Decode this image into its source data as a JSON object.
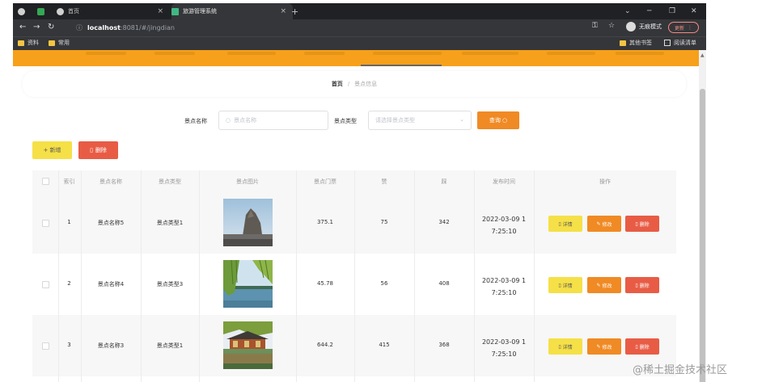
{
  "browser": {
    "tabs": [
      {
        "title": ""
      },
      {
        "title": ""
      },
      {
        "title": "首页"
      },
      {
        "title": "旅游管理系统"
      }
    ],
    "new_tab": "+",
    "url_host": "localhost",
    "url_path": ":8081/#/jingdian",
    "incognito_label": "无痕模式",
    "update_label": "更新",
    "bookmarks": [
      {
        "label": "资料"
      },
      {
        "label": "常用"
      }
    ],
    "bookmarks_right": [
      {
        "label": "其他书签"
      },
      {
        "label": "阅读清单"
      }
    ]
  },
  "breadcrumb": {
    "home": "首页",
    "separator": "/",
    "current": "景点信息"
  },
  "search": {
    "name_label": "景点名称",
    "name_placeholder": "景点名称",
    "type_label": "景点类型",
    "type_placeholder": "请选择景点类型",
    "query_label": "查询 ○"
  },
  "toolbar": {
    "add_label": "+ 新增",
    "delete_label": "删除"
  },
  "table": {
    "headers": [
      "索引",
      "景点名称",
      "景点类型",
      "景点图片",
      "景点门票",
      "赞",
      "踩",
      "发布时间",
      "操作"
    ],
    "rows": [
      {
        "index": "1",
        "name": "景点名称5",
        "type": "景点类型1",
        "price": "375.1",
        "likes": "75",
        "dislikes": "342",
        "time_line1": "2022-03-09 1",
        "time_line2": "7:25:10"
      },
      {
        "index": "2",
        "name": "景点名称4",
        "type": "景点类型3",
        "price": "45.78",
        "likes": "56",
        "dislikes": "408",
        "time_line1": "2022-03-09 1",
        "time_line2": "7:25:10"
      },
      {
        "index": "3",
        "name": "景点名称3",
        "type": "景点类型1",
        "price": "644.2",
        "likes": "415",
        "dislikes": "368",
        "time_line1": "2022-03-09 1",
        "time_line2": "7:25:10"
      }
    ],
    "actions": {
      "detail": "详情",
      "edit": "修改",
      "remove": "删除"
    }
  },
  "watermark": "@稀土掘金技术社区",
  "colors": {
    "header_orange": "#f7a01b",
    "query_orange": "#f08a24",
    "add_yellow": "#f5e047",
    "delete_red": "#e85c45"
  }
}
